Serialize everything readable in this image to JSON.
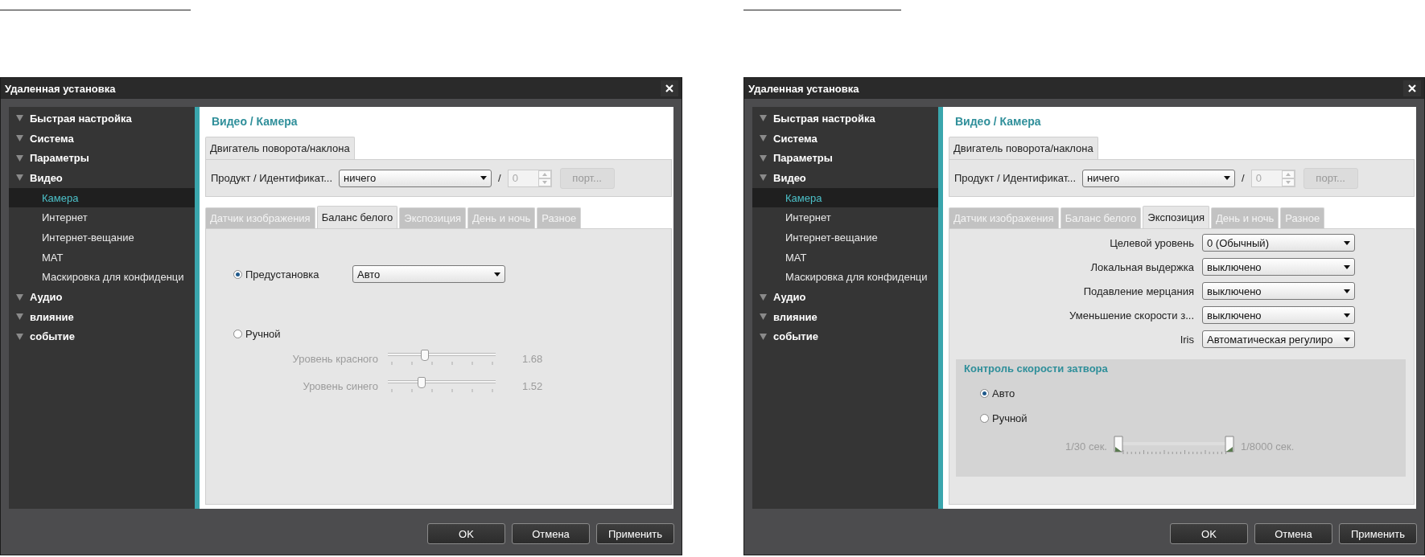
{
  "dialogs": [
    {
      "title": "Удаленная установка",
      "sidebar": {
        "items": [
          {
            "label": "Быстрая настройка",
            "selected": false
          },
          {
            "label": "Система",
            "selected": false
          },
          {
            "label": "Параметры",
            "selected": false
          },
          {
            "label": "Видео",
            "selected": false,
            "children": [
              {
                "label": "Камера",
                "selected": true
              },
              {
                "label": "Интернет",
                "selected": false
              },
              {
                "label": "Интернет-вещание",
                "selected": false
              },
              {
                "label": "MAT",
                "selected": false
              },
              {
                "label": "Маскировка для конфиденци",
                "selected": false
              }
            ]
          },
          {
            "label": "Аудио",
            "selected": false
          },
          {
            "label": "влияние",
            "selected": false
          },
          {
            "label": "событие",
            "selected": false
          }
        ]
      },
      "heading": "Видео / Камера",
      "top_tabs": [
        {
          "label": "Двигатель поворота/наклона",
          "selected": true
        }
      ],
      "product": {
        "label": "Продукт / Идентификат...",
        "value": "ничего",
        "separator": "/",
        "id_value": "0",
        "button": "порт...",
        "disabled": true
      },
      "tabs": [
        {
          "label": "Датчик изображения",
          "selected": false
        },
        {
          "label": "Баланс белого",
          "selected": true
        },
        {
          "label": "Экспозиция",
          "selected": false
        },
        {
          "label": "День и ночь",
          "selected": false
        },
        {
          "label": "Разное",
          "selected": false
        }
      ],
      "panel": {
        "kind": "white_balance",
        "options": [
          {
            "label": "Предустановка",
            "selected": true,
            "value": "Авто"
          },
          {
            "label": "Ручной",
            "selected": false
          }
        ],
        "sliders": [
          {
            "label": "Уровень красного",
            "level": 0.33,
            "reading": "1.68",
            "disabled": true
          },
          {
            "label": "Уровень синего",
            "level": 0.3,
            "reading": "1.52",
            "disabled": true
          }
        ]
      },
      "buttons": [
        "OK",
        "Отмена",
        "Применить"
      ]
    },
    {
      "title": "Удаленная установка",
      "sidebar": {
        "items": [
          {
            "label": "Быстрая настройка",
            "selected": false
          },
          {
            "label": "Система",
            "selected": false
          },
          {
            "label": "Параметры",
            "selected": false
          },
          {
            "label": "Видео",
            "selected": false,
            "children": [
              {
                "label": "Камера",
                "selected": true
              },
              {
                "label": "Интернет",
                "selected": false
              },
              {
                "label": "Интернет-вещание",
                "selected": false
              },
              {
                "label": "MAT",
                "selected": false
              },
              {
                "label": "Маскировка для конфиденци",
                "selected": false
              }
            ]
          },
          {
            "label": "Аудио",
            "selected": false
          },
          {
            "label": "влияние",
            "selected": false
          },
          {
            "label": "событие",
            "selected": false
          }
        ]
      },
      "heading": "Видео / Камера",
      "top_tabs": [
        {
          "label": "Двигатель поворота/наклона",
          "selected": true
        }
      ],
      "product": {
        "label": "Продукт / Идентификат...",
        "value": "ничего",
        "separator": "/",
        "id_value": "0",
        "button": "порт...",
        "disabled": true
      },
      "tabs": [
        {
          "label": "Датчик изображения",
          "selected": false
        },
        {
          "label": "Баланс белого",
          "selected": false
        },
        {
          "label": "Экспозиция",
          "selected": true
        },
        {
          "label": "День и ночь",
          "selected": false
        },
        {
          "label": "Разное",
          "selected": false
        }
      ],
      "panel": {
        "kind": "exposure",
        "fields": [
          {
            "label": "Целевой уровень",
            "value": "0 (Обычный)"
          },
          {
            "label": "Локальная выдержка",
            "value": "выключено"
          },
          {
            "label": "Подавление мерцания",
            "value": "выключено"
          },
          {
            "label": "Уменьшение скорости з...",
            "value": "выключено"
          },
          {
            "label": "Iris",
            "value": "Автоматическая регулиро"
          }
        ],
        "group": {
          "title": "Контроль скорости затвора",
          "options": [
            {
              "label": "Авто",
              "selected": true
            },
            {
              "label": "Ручной",
              "selected": false
            }
          ],
          "range": {
            "min_label": "1/30 сек.",
            "max_label": "1/8000 сек.",
            "disabled": true,
            "thumbs": [
              {
                "level": 0
              },
              {
                "level": 1
              }
            ]
          }
        }
      },
      "buttons": [
        "OK",
        "Отмена",
        "Применить"
      ]
    }
  ]
}
